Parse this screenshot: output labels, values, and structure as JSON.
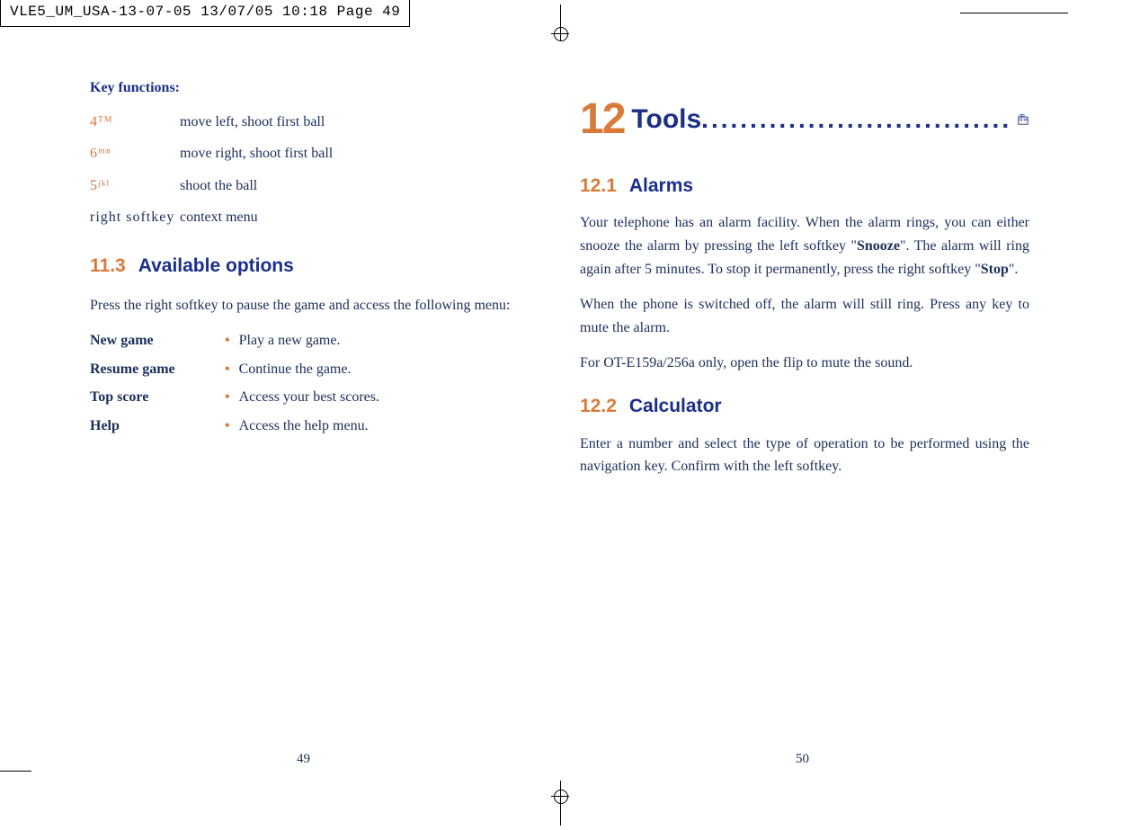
{
  "print_header": "VLE5_UM_USA-13-07-05  13/07/05  10:18  Page 49",
  "left_page": {
    "key_functions_title": "Key functions:",
    "keys": [
      {
        "label": "4ᵀᴹ",
        "desc": "move left, shoot first ball"
      },
      {
        "label": "6ᵐⁿ",
        "desc": "move right, shoot first ball"
      },
      {
        "label": "5ʲᵏˡ",
        "desc": "shoot the ball"
      },
      {
        "label": "right softkey",
        "desc": "context menu"
      }
    ],
    "section_11_3": {
      "num": "11.3",
      "title": "Available options",
      "intro": "Press the right softkey to pause the game and access the following menu:",
      "options": [
        {
          "name": "New game",
          "desc": "Play a new game."
        },
        {
          "name": "Resume game",
          "desc": "Continue the game."
        },
        {
          "name": "Top score",
          "desc": "Access your best scores."
        },
        {
          "name": "Help",
          "desc": "Access the help menu."
        }
      ]
    },
    "page_number": "49"
  },
  "right_page": {
    "chapter": {
      "num": "12",
      "title": "Tools",
      "dots": "................................"
    },
    "section_12_1": {
      "num": "12.1",
      "title": "Alarms",
      "para1_a": "Your telephone has an alarm facility. When the alarm rings, you can either snooze the alarm by pressing the left softkey \"",
      "snooze": "Snooze",
      "para1_b": "\". The alarm will ring again after 5 minutes. To stop it permanently, press the right softkey \"",
      "stop": "Stop",
      "para1_c": "\".",
      "para2": "When the phone is switched off, the alarm will still ring. Press any key to mute the alarm.",
      "para3": "For OT-E159a/256a only, open the flip to mute the sound."
    },
    "section_12_2": {
      "num": "12.2",
      "title": "Calculator",
      "para1": "Enter a number and select the type of operation to be performed using the navigation key. Confirm with the left softkey."
    },
    "page_number": "50"
  }
}
